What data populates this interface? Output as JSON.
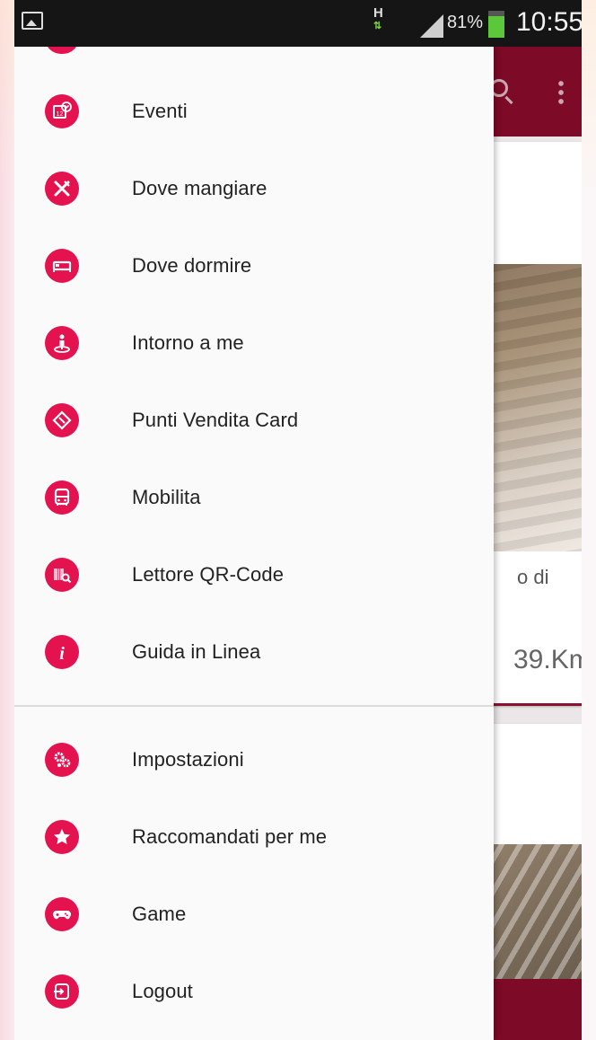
{
  "status_bar": {
    "network_type": "H",
    "battery_percent": "81%",
    "battery_level": 0.81,
    "time": "10:55"
  },
  "background_app": {
    "card1_text_fragment": "o di",
    "card1_distance_fragment": "39.Km"
  },
  "drawer": {
    "primary_items": [
      {
        "label": "Eventi",
        "icon": "calendar-icon"
      },
      {
        "label": "Dove mangiare",
        "icon": "fork-knife-icon"
      },
      {
        "label": "Dove dormire",
        "icon": "bed-icon"
      },
      {
        "label": "Intorno a me",
        "icon": "person-location-icon"
      },
      {
        "label": "Punti Vendita Card",
        "icon": "ticket-icon"
      },
      {
        "label": "Mobilita",
        "icon": "bus-icon"
      },
      {
        "label": "Lettore QR-Code",
        "icon": "qr-scan-icon"
      },
      {
        "label": "Guida in Linea",
        "icon": "info-icon"
      }
    ],
    "secondary_items": [
      {
        "label": "Impostazioni",
        "icon": "gears-icon"
      },
      {
        "label": "Raccomandati per me",
        "icon": "star-icon"
      },
      {
        "label": "Game",
        "icon": "gamepad-icon"
      },
      {
        "label": "Logout",
        "icon": "logout-icon"
      }
    ]
  },
  "colors": {
    "accent": "#e4124f",
    "app_bar": "#7d0a27",
    "drawer_background": "#fafafa"
  }
}
